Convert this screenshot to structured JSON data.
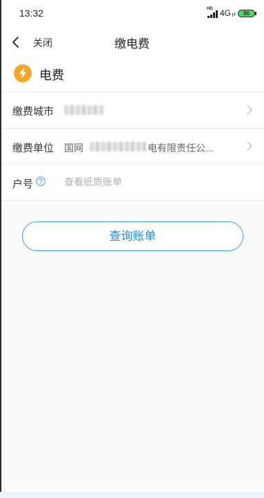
{
  "status_bar": {
    "time": "13:32",
    "hd_label": "HD",
    "network_label": "4G",
    "battery_level": "96",
    "battery_color": "#4cd964",
    "signal_icon": "signal-bars-icon"
  },
  "header": {
    "back_icon": "chevron-left-icon",
    "close_label": "关闭",
    "title": "缴电费"
  },
  "bill_type": {
    "icon": "lightning-icon",
    "icon_color": "#f5a623",
    "label": "电费"
  },
  "form": {
    "city": {
      "label": "缴费城市",
      "value_obscured": true,
      "chevron_icon": "chevron-right-icon"
    },
    "company": {
      "label": "缴费单位",
      "value_prefix": "国网",
      "value_obscured": true,
      "value_suffix": "电有限责任公...",
      "chevron_icon": "chevron-right-icon"
    },
    "account": {
      "label": "户号",
      "help_icon": "question-circle-icon",
      "placeholder": "查看纸质账单"
    }
  },
  "query_button": {
    "label": "查询账单"
  },
  "colors": {
    "accent": "#1a8cf0",
    "button_border": "#3d9ff5",
    "page_background": "#fafafa"
  }
}
